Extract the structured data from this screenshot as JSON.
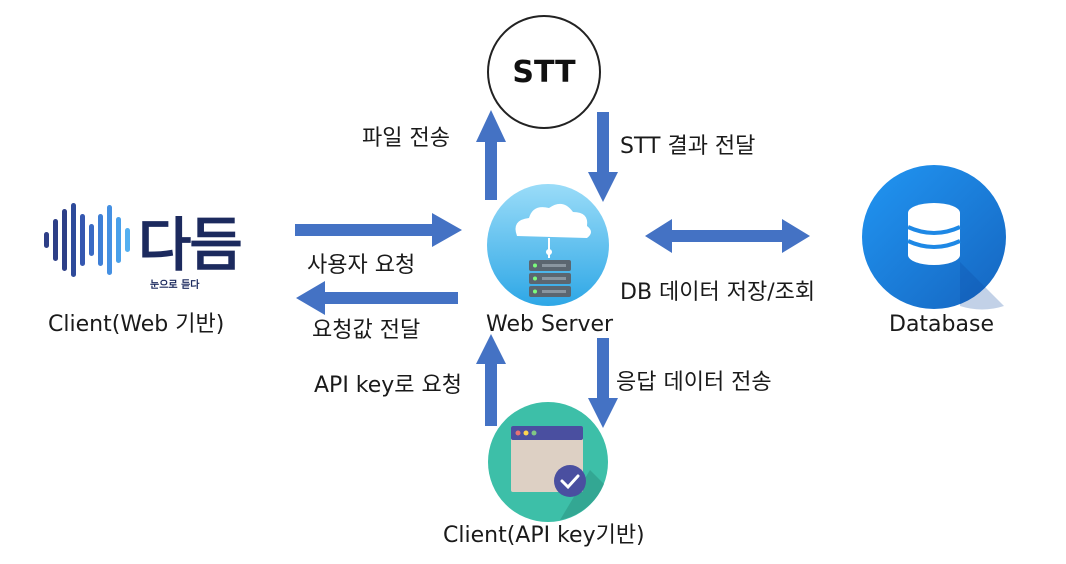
{
  "nodes": {
    "stt": "STT",
    "client_web": "Client(Web 기반)",
    "logo_main": "다듬",
    "logo_sub": "눈으로 듣다",
    "web_server": "Web Server",
    "database": "Database",
    "client_api": "Client(API key기반)"
  },
  "edges": {
    "file_send": "파일 전송",
    "stt_result": "STT 결과 전달",
    "user_request": "사용자 요청",
    "request_value": "요청값 전달",
    "db_store": "DB 데이터 저장/조회",
    "api_request": "API key로 요청",
    "response_send": "응답 데이터 전송"
  },
  "colors": {
    "arrow": "#4472c4",
    "db_circle": "#1e88e5",
    "server_circle": "#4fc3f7",
    "client_api_circle": "#26a69a"
  }
}
